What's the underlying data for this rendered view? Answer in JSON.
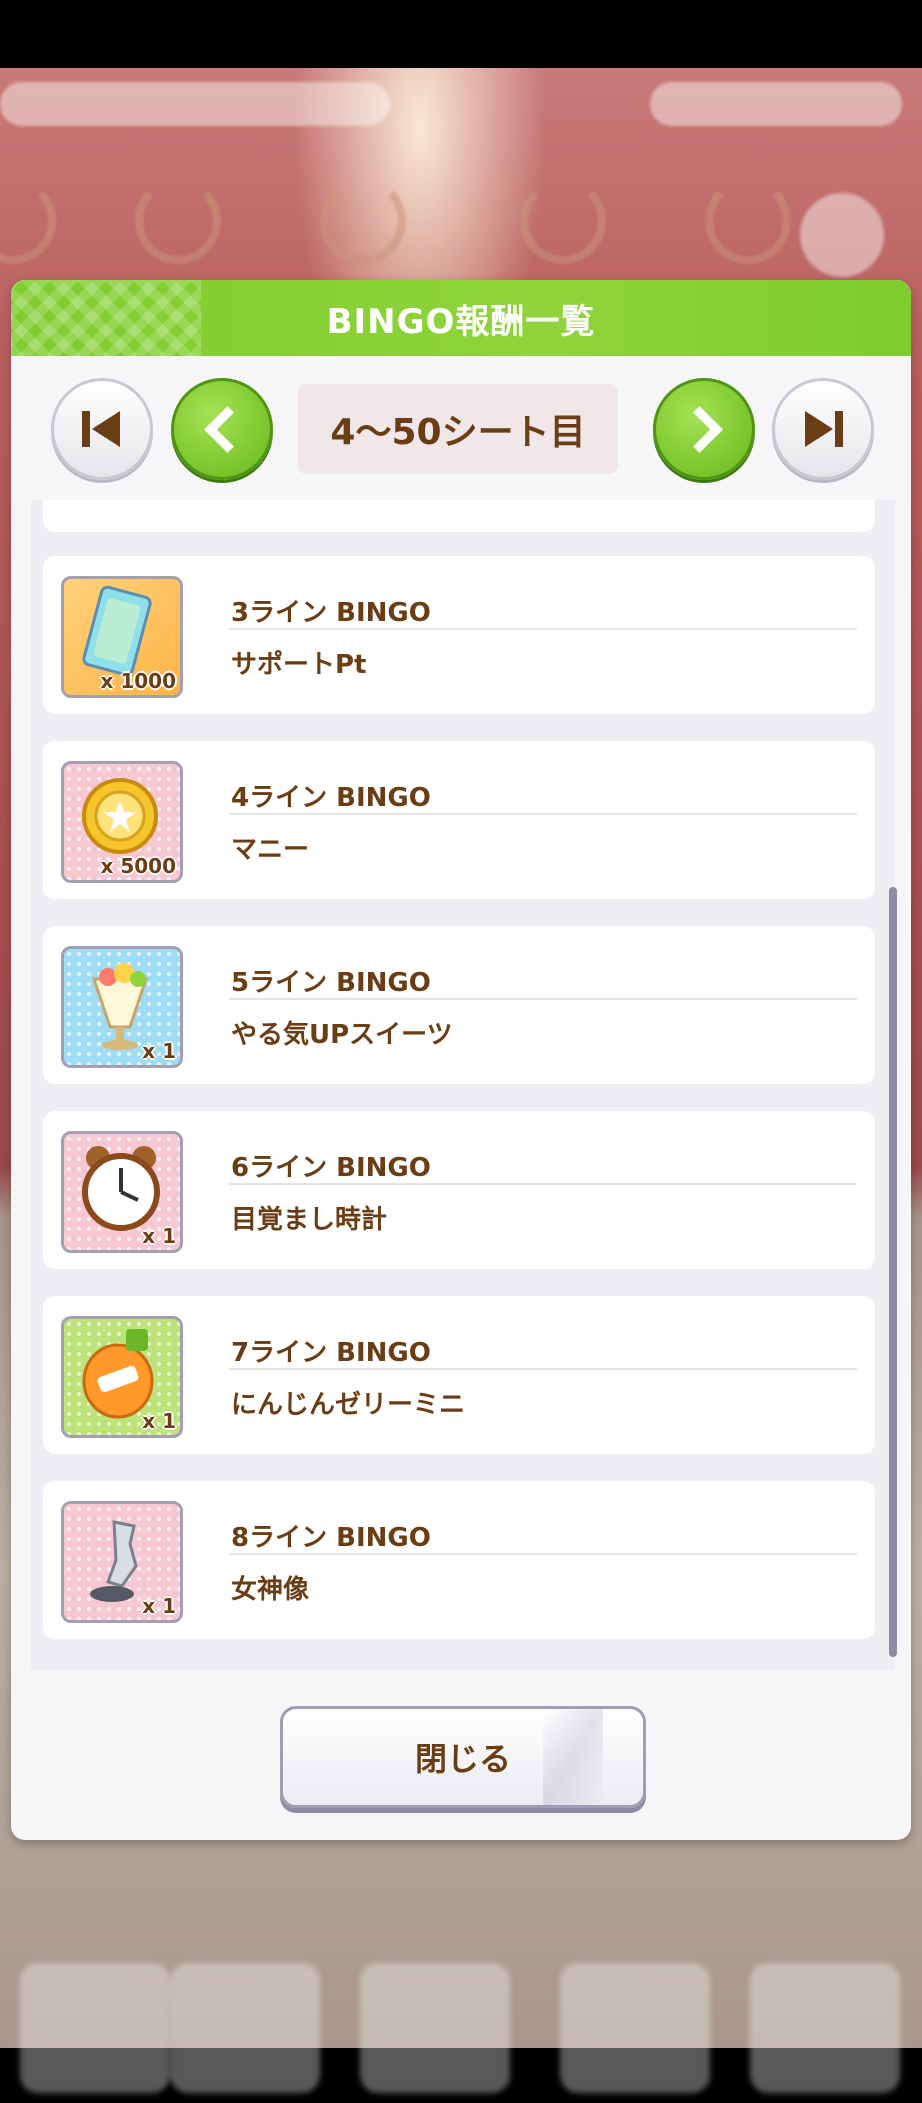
{
  "modal": {
    "title": "BINGO報酬一覧",
    "page_label": "4〜50シート目",
    "close_label": "閉じる"
  },
  "rewards": [
    {
      "line": "3ライン BINGO",
      "reward": "サポートPt",
      "qty": "x 1000",
      "icon": "support-pt-card-icon",
      "bg": "orange"
    },
    {
      "line": "4ライン BINGO",
      "reward": "マニー",
      "qty": "x 5000",
      "icon": "money-coin-icon",
      "bg": "pink"
    },
    {
      "line": "5ライン BINGO",
      "reward": "やる気UPスイーツ",
      "qty": "x 1",
      "icon": "parfait-sweets-icon",
      "bg": "blue"
    },
    {
      "line": "6ライン BINGO",
      "reward": "目覚まし時計",
      "qty": "x 1",
      "icon": "alarm-clock-icon",
      "bg": "pink"
    },
    {
      "line": "7ライン BINGO",
      "reward": "にんじんゼリーミニ",
      "qty": "x 1",
      "icon": "carrot-jelly-icon",
      "bg": "green"
    },
    {
      "line": "8ライン BINGO",
      "reward": "女神像",
      "qty": "x 1",
      "icon": "goddess-statue-icon",
      "bg": "pink"
    }
  ],
  "colors": {
    "header_green": "#8fd43a",
    "text_brown": "#6b3d14",
    "scrollbar": "#8f8aa4"
  }
}
